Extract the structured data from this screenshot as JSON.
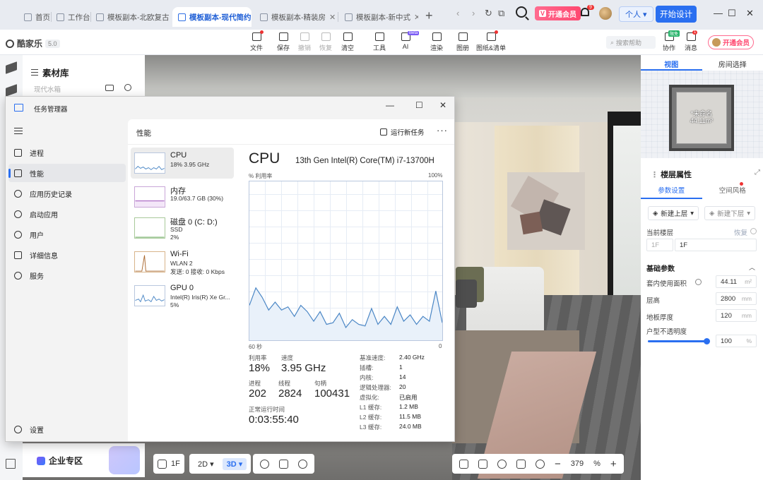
{
  "browser": {
    "tabs": [
      {
        "label": "首页"
      },
      {
        "label": "工作台"
      },
      {
        "label": "模板副本-北欧复古"
      },
      {
        "label": "模板副本-现代简约"
      },
      {
        "label": "模板副本-精装房"
      },
      {
        "label": "模板副本-新中式"
      }
    ],
    "new_tab": "+",
    "nav": [
      "‹",
      "›",
      "↻",
      "⧉"
    ],
    "vip_label": "开通会员",
    "vip_badge": "V",
    "bell_badge": "9",
    "personal_label": "个人",
    "start_design": "开始设计",
    "win_controls": [
      "—",
      "☐",
      "✕"
    ]
  },
  "toolbar": {
    "brand": "酷家乐",
    "version": "5.0",
    "tools": [
      {
        "label": "文件",
        "dot": true,
        "disabled": false
      },
      {
        "label": "保存",
        "dot": false,
        "disabled": false
      },
      {
        "label": "撤销",
        "dot": false,
        "disabled": true
      },
      {
        "label": "恢复",
        "dot": false,
        "disabled": true
      },
      {
        "label": "清空",
        "dot": false,
        "disabled": false
      },
      {
        "label": "工具",
        "dot": false,
        "disabled": false
      },
      {
        "label": "AI",
        "dot": false,
        "disabled": false,
        "beta": "Beta"
      },
      {
        "label": "渲染",
        "dot": false,
        "disabled": false
      },
      {
        "label": "图册",
        "dot": false,
        "disabled": false
      },
      {
        "label": "图纸&清单",
        "dot": true,
        "disabled": false
      }
    ],
    "help_placeholder": "搜索帮助",
    "collab_label": "协作",
    "collab_badge": "限免",
    "msg_label": "消息",
    "msg_badge": "1",
    "vip_label": "开通会员"
  },
  "material_library": {
    "title": "素材库",
    "search_placeholder": "现代水箱"
  },
  "enterprise": {
    "label": "企业专区"
  },
  "bottom_controls": {
    "floor": "1F",
    "view2d": "2D",
    "view3d": "3D",
    "zoom": "379",
    "zoom_unit": "%"
  },
  "right_panel": {
    "tabs": [
      "视图",
      "房间选择"
    ],
    "room_name": "*未命名",
    "room_area": "44.11m²",
    "floor_props_title": "楼层属性",
    "prop_tabs": [
      "参数设置",
      "空间风格"
    ],
    "add_up": "新建上层",
    "add_down": "新建下层",
    "current_floor_label": "当前楼层",
    "restore": "恢复",
    "floor_prefix": "1F",
    "floor_value": "1F",
    "basic_params": "基础参数",
    "area_label": "套内使用面积",
    "area_value": "44.11",
    "area_unit": "m²",
    "height_label": "层高",
    "height_value": "2800",
    "height_unit": "mm",
    "slab_label": "地板厚度",
    "slab_value": "120",
    "slab_unit": "mm",
    "opacity_label": "户型不透明度",
    "opacity_value": "100",
    "opacity_unit": "%",
    "opacity_fraction": 1.0
  },
  "task_manager": {
    "title": "任务管理器",
    "win_controls": [
      "—",
      "☐",
      "✕"
    ],
    "nav": [
      {
        "label": "进程",
        "active": false
      },
      {
        "label": "性能",
        "active": true
      },
      {
        "label": "应用历史记录",
        "active": false
      },
      {
        "label": "启动应用",
        "active": false
      },
      {
        "label": "用户",
        "active": false
      },
      {
        "label": "详细信息",
        "active": false
      },
      {
        "label": "服务",
        "active": false
      }
    ],
    "settings": "设置",
    "header": "性能",
    "run_task": "运行新任务",
    "more": "···",
    "resources": [
      {
        "name": "CPU",
        "line1": "18%  3.95 GHz",
        "line2": ""
      },
      {
        "name": "内存",
        "line1": "19.0/63.7 GB (30%)",
        "line2": ""
      },
      {
        "name": "磁盘 0 (C: D:)",
        "line1": "SSD",
        "line2": "2%"
      },
      {
        "name": "Wi-Fi",
        "line1": "WLAN 2",
        "line2": "发送: 0 接收: 0 Kbps"
      },
      {
        "name": "GPU 0",
        "line1": "Intel(R) Iris(R) Xe Gr...",
        "line2": "5%"
      }
    ],
    "cpu": {
      "title": "CPU",
      "model": "13th Gen Intel(R) Core(TM) i7-13700H",
      "util_label": "% 利用率",
      "max_label": "100%",
      "time_left": "60 秒",
      "time_right": "0",
      "utilization_label": "利用率",
      "utilization": "18%",
      "speed_label": "速度",
      "speed": "3.95 GHz",
      "processes_label": "进程",
      "processes": "202",
      "threads_label": "线程",
      "threads": "2824",
      "handles_label": "句柄",
      "handles": "100431",
      "uptime_label": "正常运行时间",
      "uptime": "0:03:55:40",
      "specs": [
        {
          "k": "基准速度:",
          "v": "2.40 GHz"
        },
        {
          "k": "插槽:",
          "v": "1"
        },
        {
          "k": "内核:",
          "v": "14"
        },
        {
          "k": "逻辑处理器:",
          "v": "20"
        },
        {
          "k": "虚拟化:",
          "v": "已启用"
        },
        {
          "k": "L1 缓存:",
          "v": "1.2 MB"
        },
        {
          "k": "L2 缓存:",
          "v": "11.5 MB"
        },
        {
          "k": "L3 缓存:",
          "v": "24.0 MB"
        }
      ]
    }
  },
  "chart_data": {
    "type": "area",
    "x": [
      60,
      58,
      56,
      54,
      52,
      50,
      48,
      46,
      44,
      42,
      40,
      38,
      36,
      34,
      32,
      30,
      28,
      26,
      24,
      22,
      20,
      18,
      16,
      14,
      12,
      10,
      8,
      6,
      4,
      2,
      0
    ],
    "series": [
      {
        "values": [
          22,
          33,
          27,
          19,
          24,
          19,
          21,
          15,
          22,
          18,
          12,
          18,
          10,
          11,
          17,
          8,
          13,
          10,
          9,
          20,
          10,
          15,
          10,
          21,
          12,
          16,
          10,
          15,
          12,
          31,
          11
        ]
      }
    ],
    "ylim": [
      0,
      100
    ],
    "xlim": [
      60,
      0
    ]
  },
  "watermark": {
    "text": "值 什么值得买",
    "site": "SMYZ.NET"
  },
  "colors": {
    "accent": "#2a6ff0",
    "vip": "#ff4870",
    "cpu_line": "#4a86c5",
    "cpu_fill": "#e9f1fa"
  }
}
